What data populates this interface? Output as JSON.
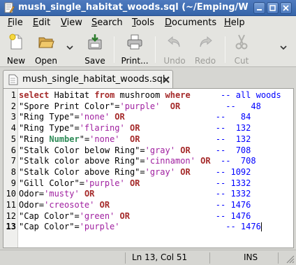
{
  "window": {
    "title": "mush_single_habitat_woods.sql (~/Emping/WE"
  },
  "menu": [
    {
      "pre": "",
      "ul": "F",
      "post": "ile"
    },
    {
      "pre": "",
      "ul": "E",
      "post": "dit"
    },
    {
      "pre": "",
      "ul": "V",
      "post": "iew"
    },
    {
      "pre": "",
      "ul": "S",
      "post": "earch"
    },
    {
      "pre": "",
      "ul": "T",
      "post": "ools"
    },
    {
      "pre": "",
      "ul": "D",
      "post": "ocuments"
    },
    {
      "pre": "",
      "ul": "H",
      "post": "elp"
    }
  ],
  "toolbar": {
    "new": "New",
    "open": "Open",
    "save": "Save",
    "print": "Print...",
    "undo": "Undo",
    "redo": "Redo",
    "cut": "Cut"
  },
  "tab": {
    "label": "mush_single_habitat_woods.sql"
  },
  "editor": {
    "current_line": 13,
    "lines": [
      [
        [
          "kw",
          "select"
        ],
        [
          "p",
          " Habitat "
        ],
        [
          "kw",
          "from"
        ],
        [
          "p",
          " mushroom "
        ],
        [
          "kw",
          "where"
        ],
        [
          "p",
          "      "
        ],
        [
          "cm",
          "-- all woods"
        ]
      ],
      [
        [
          "p",
          "\"Spore Print Color\"="
        ],
        [
          "str",
          "'purple'"
        ],
        [
          "p",
          "  "
        ],
        [
          "kw",
          "OR"
        ],
        [
          "p",
          "         "
        ],
        [
          "cm",
          "--   48"
        ]
      ],
      [
        [
          "p",
          "\"Ring Type\"="
        ],
        [
          "str",
          "'none'"
        ],
        [
          "p",
          " "
        ],
        [
          "kw",
          "OR"
        ],
        [
          "p",
          "                  "
        ],
        [
          "cm",
          "--   84"
        ]
      ],
      [
        [
          "p",
          "\"Ring Type\"="
        ],
        [
          "str",
          "'flaring'"
        ],
        [
          "p",
          " "
        ],
        [
          "kw",
          "OR"
        ],
        [
          "p",
          "               "
        ],
        [
          "cm",
          "--  132"
        ]
      ],
      [
        [
          "p",
          "\"Ring "
        ],
        [
          "ty",
          "Number"
        ],
        [
          "p",
          "\"="
        ],
        [
          "str",
          "'none'"
        ],
        [
          "p",
          "  "
        ],
        [
          "kw",
          "OR"
        ],
        [
          "p",
          "               "
        ],
        [
          "cm",
          "--  132"
        ]
      ],
      [
        [
          "p",
          "\"Stalk Color below Ring\"="
        ],
        [
          "str",
          "'gray'"
        ],
        [
          "p",
          " "
        ],
        [
          "kw",
          "OR"
        ],
        [
          "p",
          "     "
        ],
        [
          "cm",
          "--  708"
        ]
      ],
      [
        [
          "p",
          "\"Stalk color above Ring\"="
        ],
        [
          "str",
          "'cinnamon'"
        ],
        [
          "p",
          " "
        ],
        [
          "kw",
          "OR"
        ],
        [
          "p",
          "  "
        ],
        [
          "cm",
          "--  708"
        ]
      ],
      [
        [
          "p",
          "\"Stalk Color above Ring\"="
        ],
        [
          "str",
          "'gray'"
        ],
        [
          "p",
          " "
        ],
        [
          "kw",
          "OR"
        ],
        [
          "p",
          "     "
        ],
        [
          "cm",
          "-- 1092"
        ]
      ],
      [
        [
          "p",
          "\"Gill Color\"="
        ],
        [
          "str",
          "'purple'"
        ],
        [
          "p",
          " "
        ],
        [
          "kw",
          "OR"
        ],
        [
          "p",
          "               "
        ],
        [
          "cm",
          "-- 1332"
        ]
      ],
      [
        [
          "p",
          "Odor="
        ],
        [
          "str",
          "'musty'"
        ],
        [
          "p",
          " "
        ],
        [
          "kw",
          "OR"
        ],
        [
          "p",
          "                        "
        ],
        [
          "cm",
          "-- 1332"
        ]
      ],
      [
        [
          "p",
          "Odor="
        ],
        [
          "str",
          "'creosote'"
        ],
        [
          "p",
          " "
        ],
        [
          "kw",
          "OR"
        ],
        [
          "p",
          "                     "
        ],
        [
          "cm",
          "-- 1476"
        ]
      ],
      [
        [
          "p",
          "\"Cap Color\"="
        ],
        [
          "str",
          "'green'"
        ],
        [
          "p",
          " "
        ],
        [
          "kw",
          "OR"
        ],
        [
          "p",
          "                 "
        ],
        [
          "cm",
          "-- 1476"
        ]
      ],
      [
        [
          "p",
          "\"Cap Color\"="
        ],
        [
          "str",
          "'purple'"
        ],
        [
          "p",
          "                     "
        ],
        [
          "cm",
          "-- 1476"
        ]
      ]
    ]
  },
  "status": {
    "position": "Ln 13, Col 51",
    "mode": "INS"
  }
}
